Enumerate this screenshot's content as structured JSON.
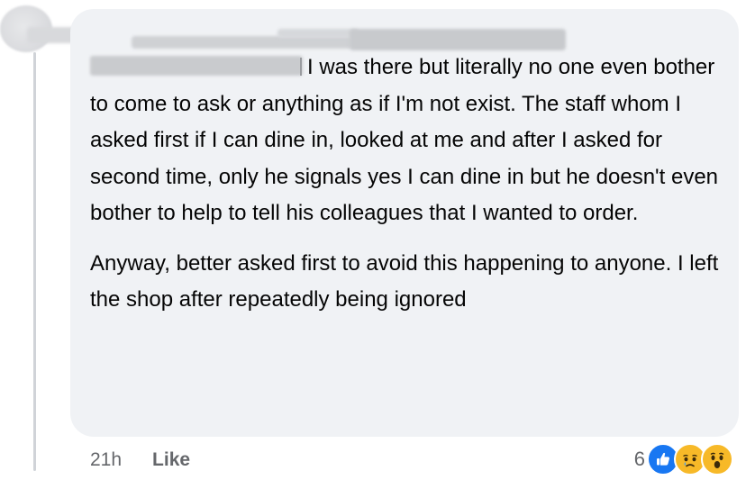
{
  "comment": {
    "paragraph_1": "I was there but literally no one even bother to come to ask or anything as if I'm not exist. The staff whom I asked first if I can dine in, looked at me and after I asked for second time, only he signals yes I can dine in but he doesn't even bother to help to tell his colleagues that I wanted to order.",
    "paragraph_2": "Anyway, better asked first to avoid this happening to anyone. I left the shop after repeatedly being ignored"
  },
  "actions": {
    "time": "21h",
    "like_label": "Like"
  },
  "reactions": {
    "count": "6",
    "icons": [
      "like-icon",
      "sad-icon",
      "wow-icon"
    ],
    "colors": {
      "like": "#1877f2",
      "emoji": "#f7b928"
    }
  },
  "colors": {
    "bubble_bg": "#f0f2f5",
    "text": "#050505",
    "meta_text": "#65676b"
  }
}
